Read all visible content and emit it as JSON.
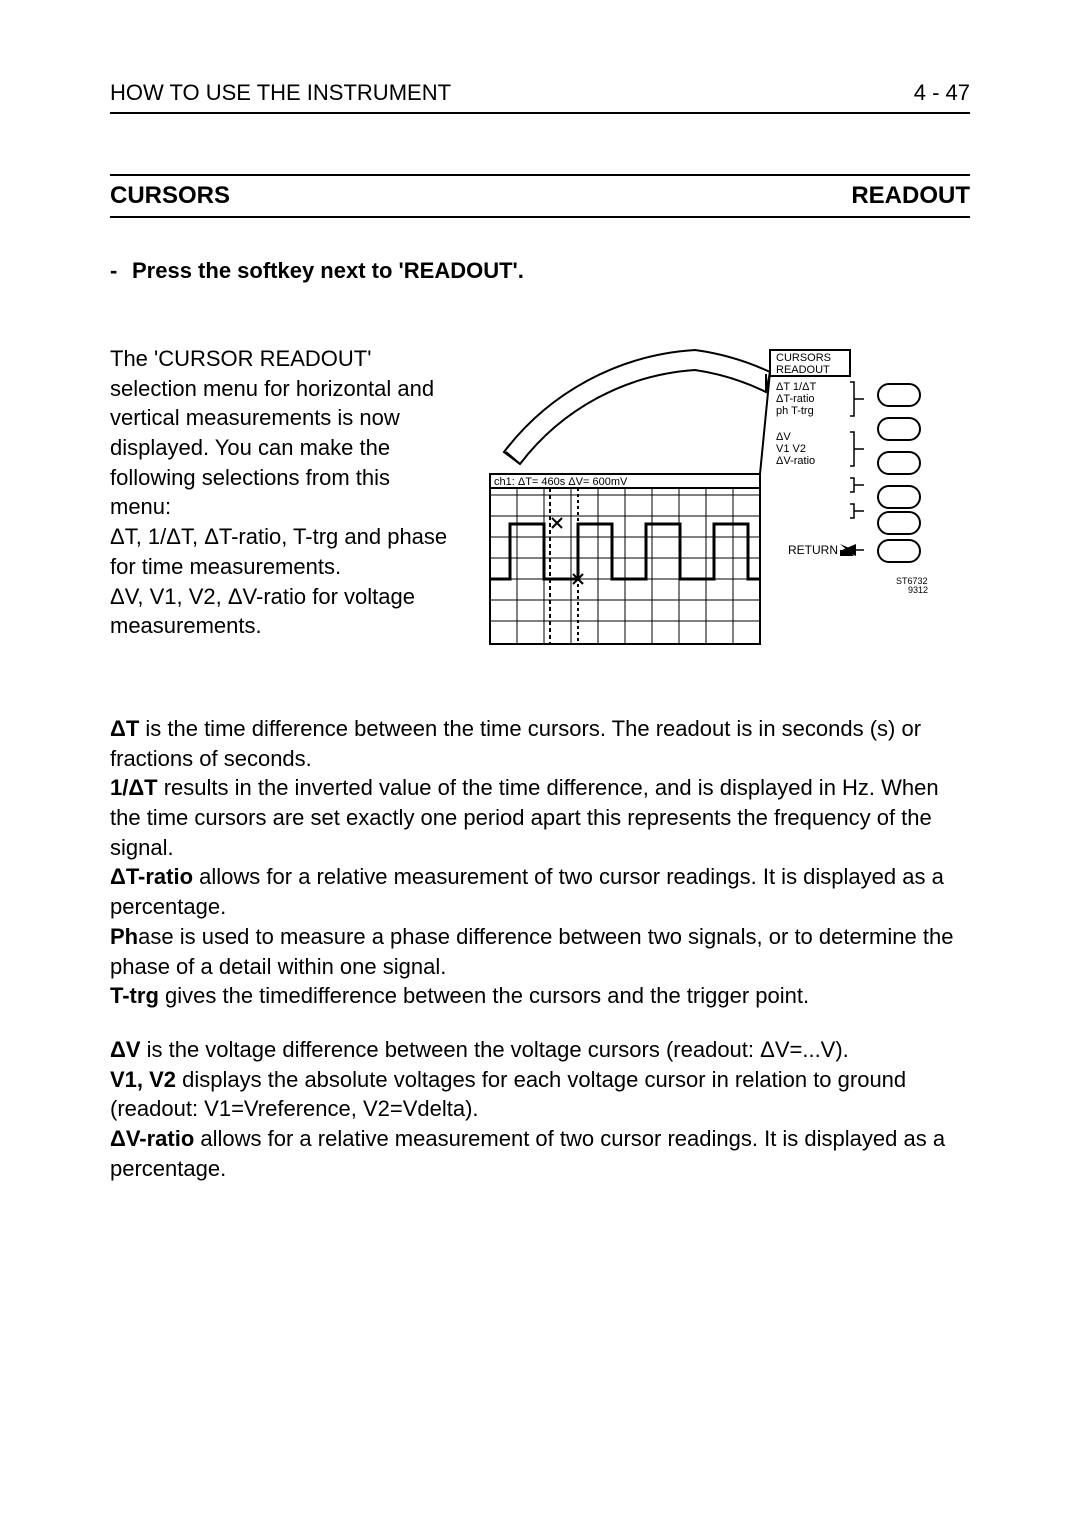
{
  "header": {
    "left": "HOW TO USE THE INSTRUMENT",
    "right": "4 - 47"
  },
  "section": {
    "left": "CURSORS",
    "right": "READOUT"
  },
  "instruction": "Press the softkey next to 'READOUT'.",
  "intro": {
    "l1": "The 'CURSOR READOUT'",
    "l2": "selection menu for horizontal and",
    "l3": "vertical measurements is now",
    "l4": "displayed. You can make the",
    "l5": "following selections from this menu:",
    "l6": "ΔT, 1/ΔT, ΔT-ratio, T-trg and phase",
    "l7": "for time measurements.",
    "l8": "ΔV, V1, V2, ΔV-ratio for voltage",
    "l9": "measurements."
  },
  "scope": {
    "menu_title_1": "CURSORS",
    "menu_title_2": "READOUT",
    "row1a": "ΔT 1/ΔT",
    "row1b": "ΔT-ratio",
    "row1c": "ph   T-trg",
    "row2a": "ΔV",
    "row2b": "V1  V2",
    "row2c": "ΔV-ratio",
    "return": "RETURN",
    "readout": "ch1: ΔT= 460s ΔV= 600mV",
    "ref": "ST6732\n9312"
  },
  "defs": {
    "dT_b": "ΔT",
    "dT_t": " is the time difference between the time cursors. The readout is in seconds (s) or fractions of seconds.",
    "inv_b": "1/ΔT",
    "inv_t": " results in the inverted value of the time difference, and is displayed in Hz. When the time cursors are set exactly one period apart this represents the frequency of the signal.",
    "tr_b": "ΔT-ratio",
    "tr_t": " allows for a relative measurement of two cursor readings. It is displayed as a percentage.",
    "ph_b": "Ph",
    "ph_t": "ase is used to measure a phase difference between two signals, or to determine the phase of a detail within one signal.",
    "ttrg_b": "T-trg",
    "ttrg_t": " gives the timedifference between the cursors and the trigger point.",
    "dV_b": "ΔV",
    "dV_t": " is the voltage difference between the voltage cursors (readout: ΔV=...V).",
    "v12_b": "V1, V2",
    "v12_t": " displays the absolute voltages for each voltage cursor in relation to ground (readout: V1=Vreference, V2=Vdelta).",
    "vr_b": "ΔV-ratio",
    "vr_t": " allows for a relative measurement of two cursor readings. It is displayed as a percentage."
  }
}
